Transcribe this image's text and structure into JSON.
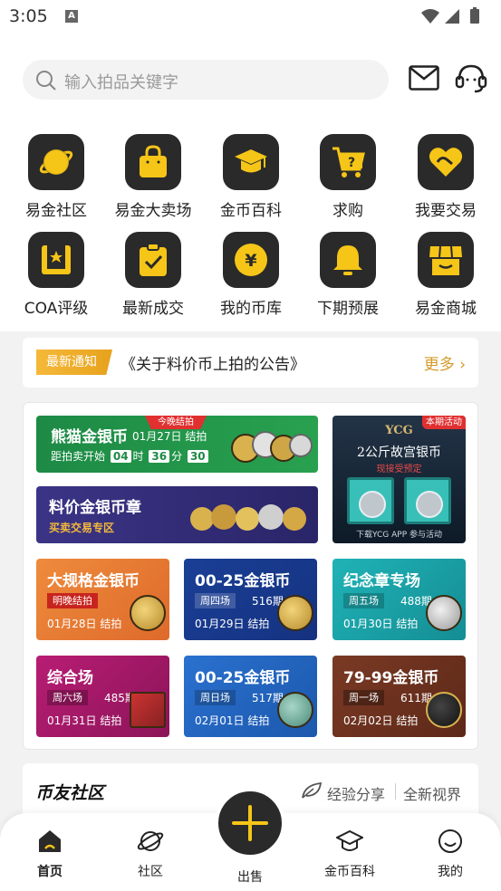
{
  "status_bar": {
    "time": "3:05"
  },
  "search": {
    "placeholder": "输入拍品关键字"
  },
  "grid": [
    {
      "label": "易金社区",
      "icon": "planet-icon"
    },
    {
      "label": "易金大卖场",
      "icon": "shopping-bag-icon"
    },
    {
      "label": "金币百科",
      "icon": "graduation-cap-icon"
    },
    {
      "label": "求购",
      "icon": "cart-question-icon"
    },
    {
      "label": "我要交易",
      "icon": "handshake-heart-icon"
    },
    {
      "label": "COA评级",
      "icon": "rating-badge-icon"
    },
    {
      "label": "最新成交",
      "icon": "clipboard-check-icon"
    },
    {
      "label": "我的币库",
      "icon": "yuan-coin-icon"
    },
    {
      "label": "下期预展",
      "icon": "bell-icon"
    },
    {
      "label": "易金商城",
      "icon": "storefront-icon"
    }
  ],
  "notice": {
    "tag": "最新通知",
    "text": "《关于料价币上拍的公告》",
    "more": "更多"
  },
  "auction": {
    "panda": {
      "ribbon": "今晚结拍",
      "title": "熊猫金银币",
      "date": "01月27日 结拍",
      "countdown_prefix": "距拍卖开始",
      "hours": "04",
      "h_unit": "时",
      "minutes": "36",
      "m_unit": "分",
      "seconds": "30"
    },
    "mixed": {
      "title": "料价金银币章",
      "subtitle": "买卖交易专区"
    },
    "ycg": {
      "ribbon": "本期活动",
      "logo": "YCG",
      "title": "2公斤故宫银币",
      "subtitle": "现接受预定",
      "footer": "下载YCG APP 参与活动"
    },
    "sessions": [
      {
        "title": "大规格金银币",
        "tag": "明晚结拍",
        "number": "",
        "date": "01月28日 结拍",
        "color": "orange"
      },
      {
        "title": "00-25金银币",
        "tag": "周四场",
        "number": "516期",
        "date": "01月29日 结拍",
        "color": "blue"
      },
      {
        "title": "纪念章专场",
        "tag": "周五场",
        "number": "488期",
        "date": "01月30日 结拍",
        "color": "teal"
      },
      {
        "title": "综合场",
        "tag": "周六场",
        "number": "485期",
        "date": "01月31日 结拍",
        "color": "purple"
      },
      {
        "title": "00-25金银币",
        "tag": "周日场",
        "number": "517期",
        "date": "02月01日 结拍",
        "color": "blue2"
      },
      {
        "title": "79-99金银币",
        "tag": "周一场",
        "number": "611期",
        "date": "02月02日 结拍",
        "color": "brown"
      }
    ]
  },
  "community": {
    "title": "币友社区",
    "tag1": "经验分享",
    "tag2": "全新视界"
  },
  "tabbar": {
    "home": "首页",
    "community": "社区",
    "sell": "出售",
    "wiki": "金币百科",
    "mine": "我的"
  },
  "colors": {
    "accent": "#f5c518",
    "dark": "#2a2a2a",
    "notice": "#e7a21c"
  }
}
